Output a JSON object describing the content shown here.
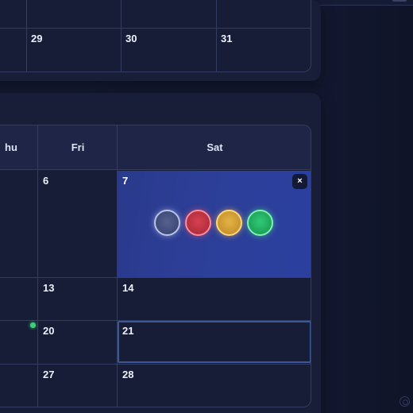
{
  "top_week": {
    "days": [
      {
        "num": "29"
      },
      {
        "num": "30"
      },
      {
        "num": "31"
      }
    ]
  },
  "calendar": {
    "headers": [
      "hu",
      "Fri",
      "Sat"
    ],
    "rows": [
      {
        "thu": "",
        "fri": "6",
        "sat": "7"
      },
      {
        "thu": "",
        "fri": "13",
        "sat": "14"
      },
      {
        "thu": "",
        "fri": "20",
        "sat": "21"
      },
      {
        "thu": "",
        "fri": "27",
        "sat": "28"
      }
    ],
    "close_label": "×",
    "swatches": [
      {
        "name": "blue-gray",
        "color": "#4f5f8f"
      },
      {
        "name": "red",
        "color": "#c93a4a"
      },
      {
        "name": "yellow",
        "color": "#d9a93a"
      },
      {
        "name": "green",
        "color": "#25b86a"
      }
    ],
    "event_dot_color": "#3fd07a"
  }
}
